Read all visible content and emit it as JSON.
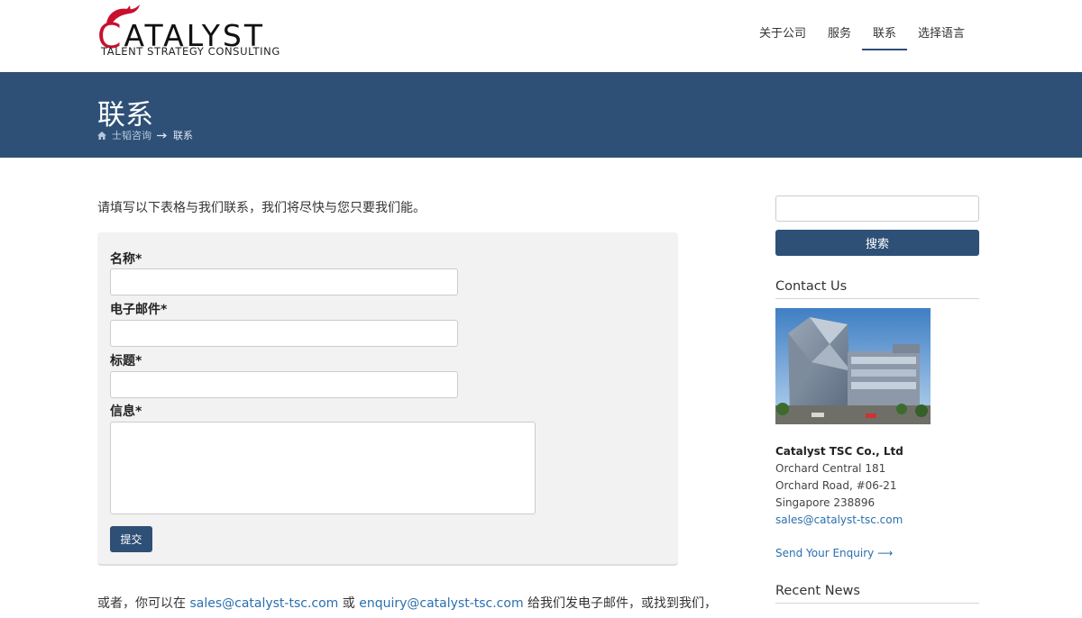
{
  "brand": {
    "name_lead": "C",
    "name_rest": "ATALYST",
    "tagline": "TALENT STRATEGY CONSULTING",
    "accent_color": "#c8102e"
  },
  "nav": {
    "items": [
      {
        "label": "关于公司"
      },
      {
        "label": "服务"
      },
      {
        "label": "联系"
      },
      {
        "label": "选择语言"
      }
    ],
    "active_index": 2
  },
  "banner": {
    "title": "联系",
    "breadcrumb_home": "士韬咨询",
    "breadcrumb_current": "联系",
    "home_icon": "home-icon",
    "separator_icon": "arrow-right-icon",
    "color": "#2e5077"
  },
  "form": {
    "intro": "请填写以下表格与我们联系，我们将尽快与您只要我们能。",
    "name_label": "名称*",
    "email_label": "电子邮件*",
    "subject_label": "标题*",
    "message_label": "信息*",
    "name_value": "",
    "email_value": "",
    "subject_value": "",
    "message_value": "",
    "submit_label": "提交"
  },
  "alt_contact": {
    "prefix": "或者，你可以在 ",
    "email1": "sales@catalyst-tsc.com",
    "middle": " 或 ",
    "email2": "enquiry@catalyst-tsc.com",
    "suffix": " 给我们发电子邮件，或找到我们，"
  },
  "sidebar": {
    "search_value": "",
    "search_button": "搜索",
    "contact_heading": "Contact Us",
    "company": "Catalyst TSC Co., Ltd",
    "addr1": "Orchard Central 181",
    "addr2": "Orchard Road, #06-21",
    "addr3": "Singapore 238896",
    "email": "sales@catalyst-tsc.com",
    "enquiry_link": "Send Your Enquiry ⟶",
    "news_heading": "Recent News",
    "link_color": "#2a6fb0"
  }
}
